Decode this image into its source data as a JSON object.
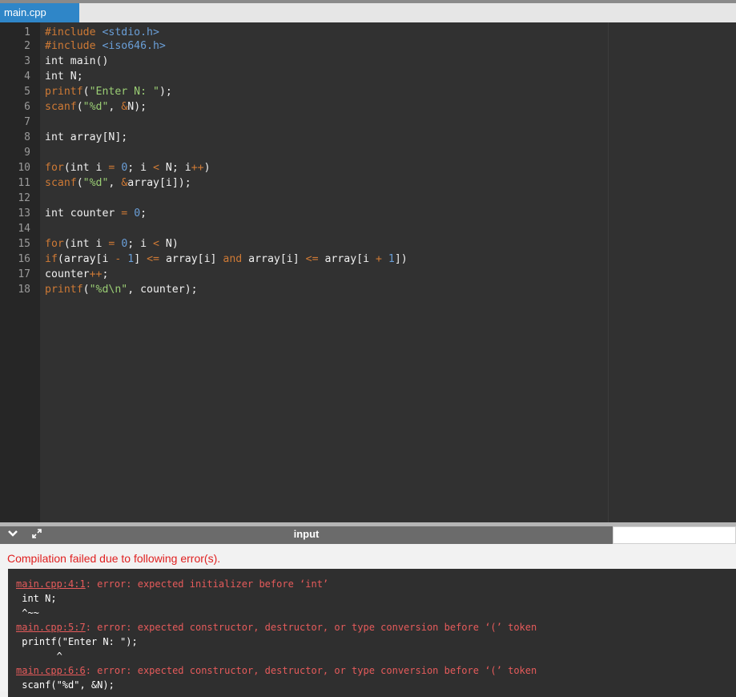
{
  "tab": {
    "label": "main.cpp"
  },
  "code": {
    "lines": [
      {
        "no": "1",
        "segments": [
          [
            "c-pre",
            "#include "
          ],
          [
            "c-hdr",
            "<stdio.h>"
          ]
        ]
      },
      {
        "no": "2",
        "segments": [
          [
            "c-pre",
            "#include "
          ],
          [
            "c-hdr",
            "<iso646.h>"
          ]
        ]
      },
      {
        "no": "3",
        "segments": [
          [
            "c-txt",
            "int main()"
          ]
        ]
      },
      {
        "no": "4",
        "segments": [
          [
            "c-txt",
            "int N;"
          ]
        ]
      },
      {
        "no": "5",
        "segments": [
          [
            "c-fn",
            "printf"
          ],
          [
            "c-txt",
            "("
          ],
          [
            "c-str",
            "\"Enter N: \""
          ],
          [
            "c-txt",
            ");"
          ]
        ]
      },
      {
        "no": "6",
        "segments": [
          [
            "c-fn",
            "scanf"
          ],
          [
            "c-txt",
            "("
          ],
          [
            "c-str",
            "\"%d\""
          ],
          [
            "c-txt",
            ", "
          ],
          [
            "c-op",
            "&"
          ],
          [
            "c-txt",
            "N);"
          ]
        ]
      },
      {
        "no": "7",
        "segments": []
      },
      {
        "no": "8",
        "segments": [
          [
            "c-txt",
            "int array[N];"
          ]
        ]
      },
      {
        "no": "9",
        "segments": []
      },
      {
        "no": "10",
        "segments": [
          [
            "c-kw",
            "for"
          ],
          [
            "c-txt",
            "(int i "
          ],
          [
            "c-op",
            "="
          ],
          [
            "c-txt",
            " "
          ],
          [
            "c-num",
            "0"
          ],
          [
            "c-txt",
            "; i "
          ],
          [
            "c-op",
            "<"
          ],
          [
            "c-txt",
            " N; i"
          ],
          [
            "c-op",
            "++"
          ],
          [
            "c-txt",
            ")"
          ]
        ]
      },
      {
        "no": "11",
        "segments": [
          [
            "c-fn",
            "scanf"
          ],
          [
            "c-txt",
            "("
          ],
          [
            "c-str",
            "\"%d\""
          ],
          [
            "c-txt",
            ", "
          ],
          [
            "c-op",
            "&"
          ],
          [
            "c-txt",
            "array[i]);"
          ]
        ]
      },
      {
        "no": "12",
        "segments": []
      },
      {
        "no": "13",
        "segments": [
          [
            "c-txt",
            "int counter "
          ],
          [
            "c-op",
            "="
          ],
          [
            "c-txt",
            " "
          ],
          [
            "c-num",
            "0"
          ],
          [
            "c-txt",
            ";"
          ]
        ]
      },
      {
        "no": "14",
        "segments": []
      },
      {
        "no": "15",
        "segments": [
          [
            "c-kw",
            "for"
          ],
          [
            "c-txt",
            "(int i "
          ],
          [
            "c-op",
            "="
          ],
          [
            "c-txt",
            " "
          ],
          [
            "c-num",
            "0"
          ],
          [
            "c-txt",
            "; i "
          ],
          [
            "c-op",
            "<"
          ],
          [
            "c-txt",
            " N)"
          ]
        ]
      },
      {
        "no": "16",
        "segments": [
          [
            "c-kw",
            "if"
          ],
          [
            "c-txt",
            "(array[i "
          ],
          [
            "c-op",
            "-"
          ],
          [
            "c-txt",
            " "
          ],
          [
            "c-num",
            "1"
          ],
          [
            "c-txt",
            "] "
          ],
          [
            "c-op",
            "<="
          ],
          [
            "c-txt",
            " array[i] "
          ],
          [
            "c-kw",
            "and"
          ],
          [
            "c-txt",
            " array[i] "
          ],
          [
            "c-op",
            "<="
          ],
          [
            "c-txt",
            " array[i "
          ],
          [
            "c-op",
            "+"
          ],
          [
            "c-txt",
            " "
          ],
          [
            "c-num",
            "1"
          ],
          [
            "c-txt",
            "])"
          ]
        ]
      },
      {
        "no": "17",
        "segments": [
          [
            "c-txt",
            "counter"
          ],
          [
            "c-op",
            "++"
          ],
          [
            "c-txt",
            ";"
          ]
        ]
      },
      {
        "no": "18",
        "segments": [
          [
            "c-fn",
            "printf"
          ],
          [
            "c-txt",
            "("
          ],
          [
            "c-str",
            "\"%d\\n\""
          ],
          [
            "c-txt",
            ", counter);"
          ]
        ]
      }
    ]
  },
  "panel": {
    "collapse_icon": "chevron-down-icon",
    "expand_icon": "expand-icon",
    "title": "input"
  },
  "output": {
    "title": "Compilation failed due to following error(s).",
    "errors": [
      {
        "loc": "main.cpp:4:1",
        "msg": ": error: expected initializer before ‘int’",
        "code": " int N;",
        "caret": " ^~~"
      },
      {
        "loc": "main.cpp:5:7",
        "msg": ": error: expected constructor, destructor, or type conversion before ‘(’ token",
        "code": " printf(\"Enter N: \");",
        "caret": "       ^"
      },
      {
        "loc": "main.cpp:6:6",
        "msg": ": error: expected constructor, destructor, or type conversion before ‘(’ token",
        "code": " scanf(\"%d\", &N);",
        "caret": ""
      }
    ]
  }
}
